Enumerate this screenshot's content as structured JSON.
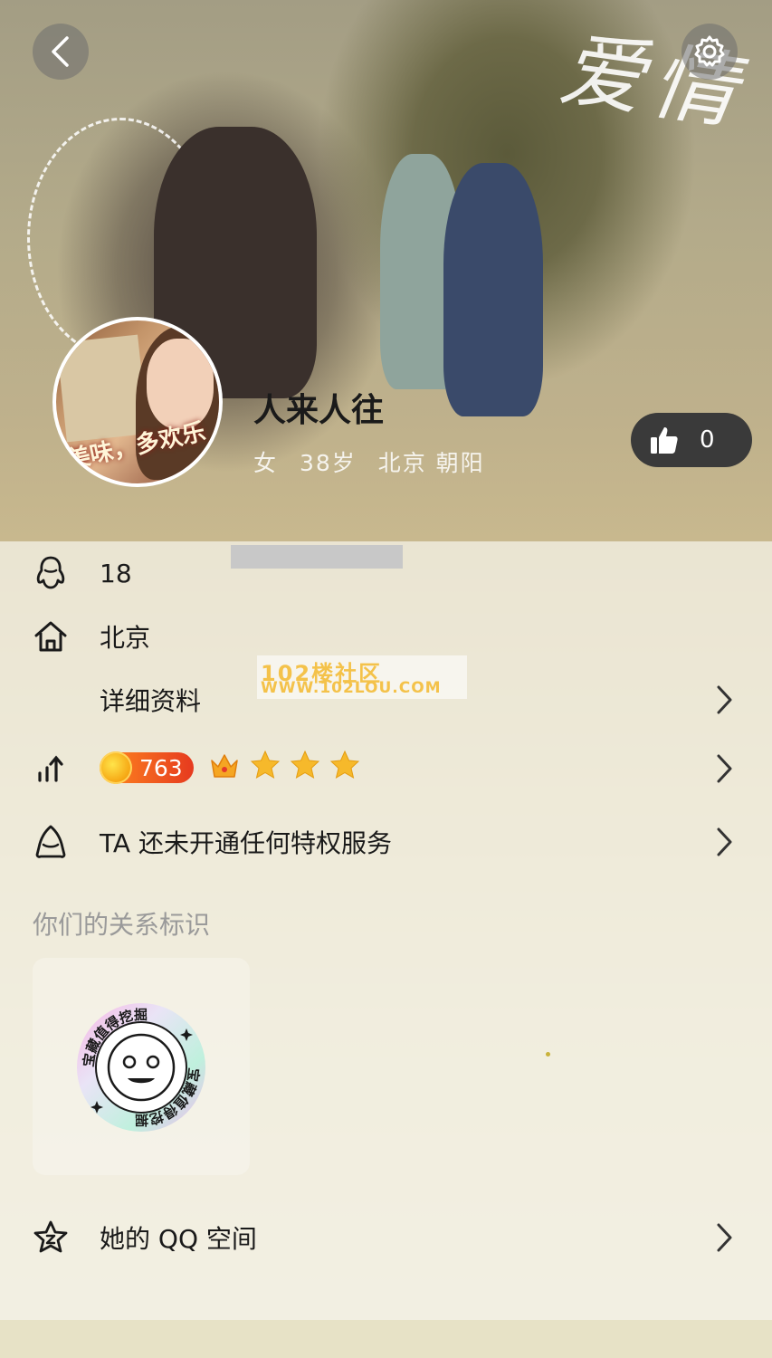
{
  "background": {
    "title_art": "爱情"
  },
  "header": {
    "back_icon": "chevron-left-icon",
    "settings_icon": "gear-icon"
  },
  "profile": {
    "avatar_text": "美味，多欢乐",
    "nickname": "人来人往",
    "gender": "女",
    "age": "38岁",
    "location": "北京 朝阳",
    "like_count": "0"
  },
  "info": {
    "qq_number_visible": "18",
    "hometown": "北京",
    "details_label": "详细资料",
    "level_value": "763",
    "privilege_text": "TA 还未开通任何特权服务"
  },
  "watermark": {
    "line1": "102楼社区",
    "line2": "WWW.102LOU.COM"
  },
  "relation": {
    "section_title": "你们的关系标识",
    "badge_text": "宝藏值得挖掘"
  },
  "qzone": {
    "label": "她的 QQ 空间"
  },
  "colors": {
    "level_badge": "#e63a1f",
    "coin": "#f5a20f",
    "like_button": "#3a3a3a"
  }
}
